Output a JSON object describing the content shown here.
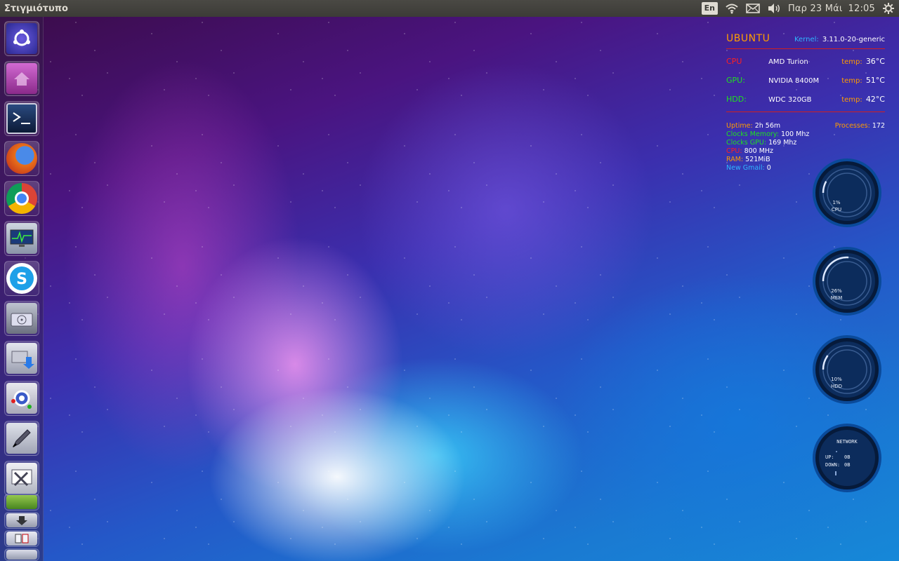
{
  "top_panel": {
    "app_title": "Στιγμιότυπο",
    "keyboard_layout": "En",
    "date": "Παρ 23 Μάι",
    "time": "12:05",
    "icons": [
      "wifi-icon",
      "mail-icon",
      "volume-icon",
      "session-gear-icon"
    ]
  },
  "launcher": {
    "items": [
      {
        "name": "ubuntu-dash",
        "icon": "ubuntu-logo-icon",
        "color": "#3c3ab0"
      },
      {
        "name": "home-folder",
        "icon": "home-folder-icon",
        "color": "#b04ab0"
      },
      {
        "name": "terminal",
        "icon": "terminal-icon",
        "color": "#1e3c6e"
      },
      {
        "name": "firefox",
        "icon": "firefox-icon",
        "color": "#e86a1a"
      },
      {
        "name": "chrome",
        "icon": "chrome-icon",
        "color": "#dddddd"
      },
      {
        "name": "system-monitor",
        "icon": "system-monitor-icon",
        "color": "#2a5aa0"
      },
      {
        "name": "skype",
        "icon": "skype-icon",
        "color": "#1ea0e8"
      },
      {
        "name": "disk-utility",
        "icon": "disk-icon",
        "color": "#8a8a9a"
      },
      {
        "name": "software-updater",
        "icon": "package-download-icon",
        "color": "#b0b0c0"
      },
      {
        "name": "system-settings",
        "icon": "settings-gears-icon",
        "color": "#c8c8d0"
      },
      {
        "name": "text-editor",
        "icon": "pen-icon",
        "color": "#9aa0b0"
      },
      {
        "name": "tools",
        "icon": "tools-icon",
        "color": "#c0c4cc"
      }
    ]
  },
  "conky": {
    "title": "UBUNTU",
    "kernel_label": "Kernel:",
    "kernel_value": "3.11.0-20-generic",
    "hardware": [
      {
        "label": "CPU",
        "model": "AMD Turion",
        "temp_label": "temp:",
        "temp_value": "36°C",
        "color": "#ff2020"
      },
      {
        "label": "GPU:",
        "model": "NVIDIA 8400M",
        "temp_label": "temp:",
        "temp_value": "51°C",
        "color": "#20e020"
      },
      {
        "label": "HDD:",
        "model": "WDC 320GB",
        "temp_label": "temp:",
        "temp_value": "42°C",
        "color": "#20e020"
      }
    ],
    "uptime_label": "Uptime:",
    "uptime_value": "2h 56m",
    "processes_label": "Processes:",
    "processes_value": "172",
    "stats": [
      {
        "label": "Clocks Memory:",
        "value": "100 Mhz",
        "color": "#20e020"
      },
      {
        "label": "Clocks GPU:",
        "value": "169 Mhz",
        "color": "#20e020"
      },
      {
        "label": "CPU:",
        "value": "800 MHz",
        "color": "#ff2020"
      },
      {
        "label": "RAM:",
        "value": "521MiB",
        "color": "#ff9c00"
      },
      {
        "label": "New Gmail:",
        "value": "0",
        "color": "#2fb6ff"
      }
    ],
    "gauges": [
      {
        "percent_text": "1%",
        "label": "CPU",
        "level": 0.01
      },
      {
        "percent_text": "26%",
        "label": "MEM",
        "level": 0.26
      },
      {
        "percent_text": "10%",
        "label": "HDD",
        "level": 0.1
      }
    ],
    "network": {
      "title": "NETWORK",
      "up_label": "UP:",
      "up_value": "0B",
      "down_label": "DOWN:",
      "down_value": "0B"
    }
  }
}
